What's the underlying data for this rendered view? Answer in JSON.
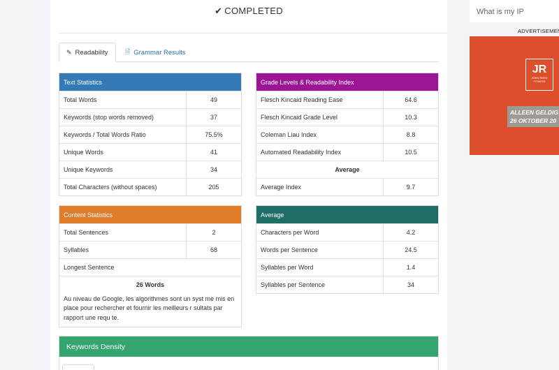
{
  "status": {
    "text": "COMPLETED",
    "icon": "check-icon"
  },
  "tabs": [
    {
      "label": "Readability",
      "icon": "pencil-icon",
      "active": true
    },
    {
      "label": "Grammar Results",
      "icon": "document-icon",
      "active": false
    }
  ],
  "text_statistics": {
    "title": "Text Statistics",
    "color": "#337ab7",
    "rows": [
      {
        "label": "Total Words",
        "value": "49"
      },
      {
        "label": "Keywords (stop words removed)",
        "value": "37"
      },
      {
        "label": "Keywords / Total Words Ratio",
        "value": "75.5%"
      },
      {
        "label": "Unique Words",
        "value": "41"
      },
      {
        "label": "Unique Keywords",
        "value": "34"
      },
      {
        "label": "Total Characters (without spaces)",
        "value": "205"
      }
    ]
  },
  "grade_levels": {
    "title": "Grade Levels & Readability Index",
    "color": "#9c1594",
    "rows": [
      {
        "label": "Flesch Kincaid Reading Ease",
        "value": "64.6"
      },
      {
        "label": "Flesch Kincaid Grade Level",
        "value": "10.3"
      },
      {
        "label": "Coleman Liau Index",
        "value": "8.8"
      },
      {
        "label": "Automated Readability Index",
        "value": "10.5"
      }
    ],
    "average_heading": "Average",
    "average_row": {
      "label": "Average Index",
      "value": "9.7"
    }
  },
  "content_statistics": {
    "title": "Content Statistics",
    "color": "#e07b2a",
    "rows": [
      {
        "label": "Total Sentences",
        "value": "2"
      },
      {
        "label": "Syllables",
        "value": "68"
      }
    ],
    "longest_label": "Longest Sentence",
    "longest_word_count": "26 Words",
    "longest_text": "Au niveau de Google, les algorithmes sont un syst me mis en place pour rechercher et fournir les meilleurs r sultats par rapport une requ te."
  },
  "average": {
    "title": "Average",
    "color": "#1e6e66",
    "rows": [
      {
        "label": "Characters per Word",
        "value": "4.2"
      },
      {
        "label": "Words per Sentence",
        "value": "24.5"
      },
      {
        "label": "Syllables per Word",
        "value": "1.4"
      },
      {
        "label": "Syllables per Sentence",
        "value": "34"
      }
    ]
  },
  "keywords_density": {
    "title": "Keywords Density",
    "color": "#34a56f"
  },
  "sidebar": {
    "search_placeholder": "What is my IP",
    "ad_label": "ADVERTISEMENT",
    "ad": {
      "logo": "JR",
      "logo_sub": "JOHN REED FITNESS",
      "banner_line1": "ALLEEN GELDIG",
      "banner_line2": "26 OKTOBER 20",
      "color": "#dd4e2c"
    }
  }
}
